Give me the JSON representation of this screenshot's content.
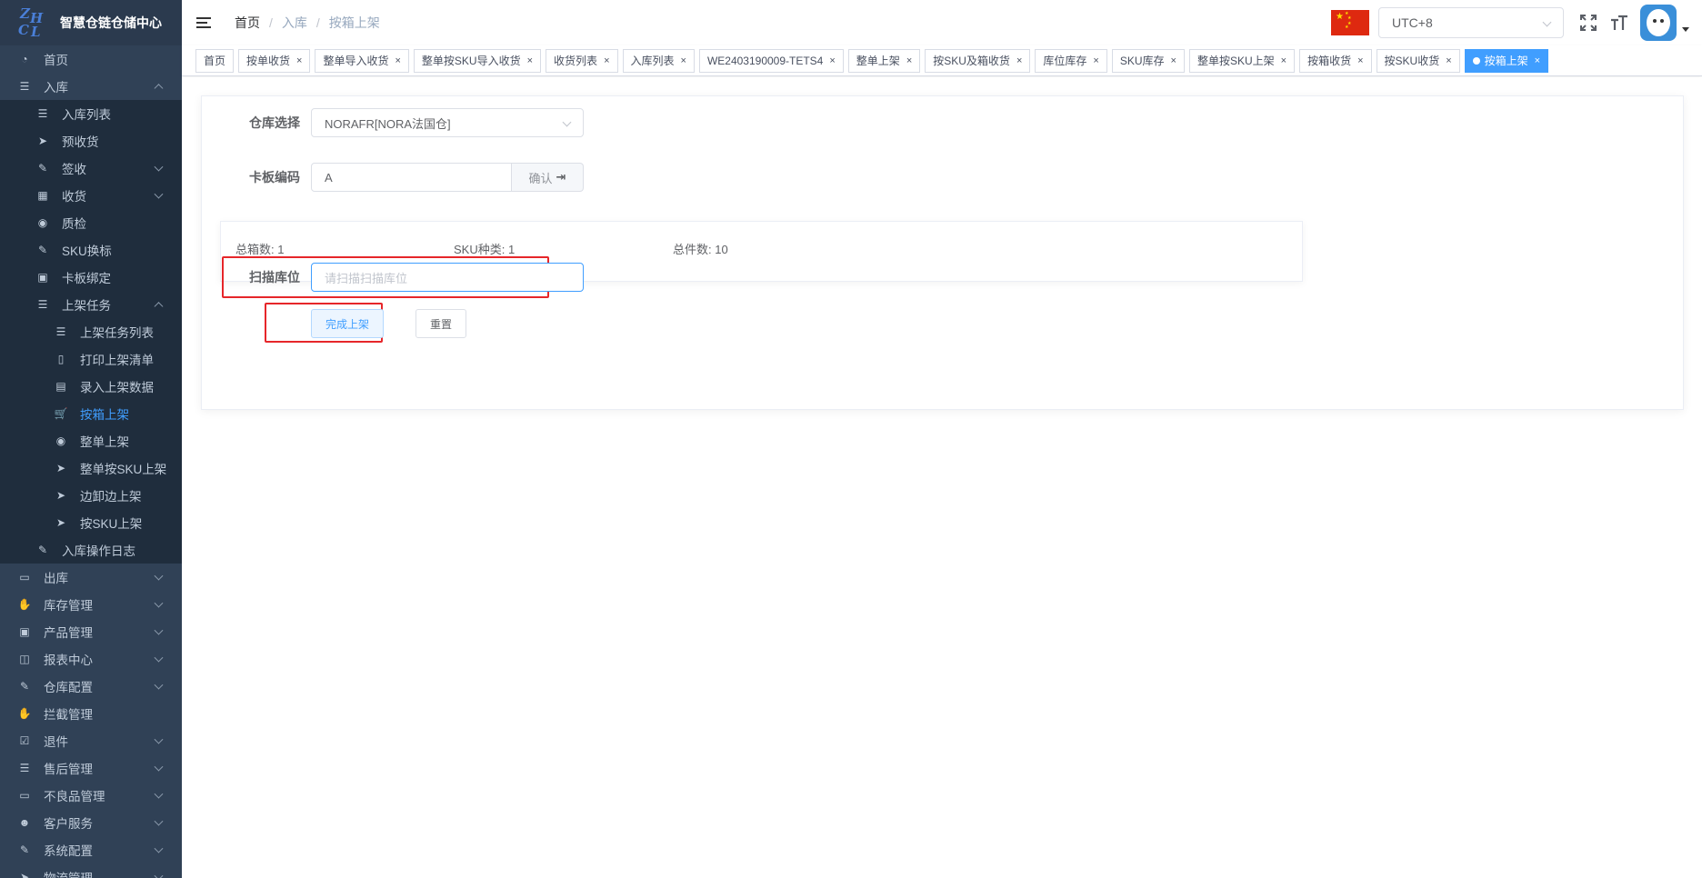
{
  "app": {
    "logo_letters": [
      "Z",
      "H",
      "C",
      "L"
    ],
    "title": "智慧仓链仓储中心"
  },
  "sidebar": {
    "items": [
      {
        "label": "首页",
        "icon": "dashboard-icon",
        "level": 1
      },
      {
        "label": "入库",
        "icon": "list-icon",
        "level": 1,
        "arrow": "up"
      },
      {
        "label": "入库列表",
        "icon": "list-icon",
        "level": 2
      },
      {
        "label": "预收货",
        "icon": "send-icon",
        "level": 2
      },
      {
        "label": "签收",
        "icon": "edit-icon",
        "level": 2,
        "arrow": "down"
      },
      {
        "label": "收货",
        "icon": "clapper-icon",
        "level": 2,
        "arrow": "down"
      },
      {
        "label": "质检",
        "icon": "eye-icon",
        "level": 2
      },
      {
        "label": "SKU换标",
        "icon": "edit-icon",
        "level": 2
      },
      {
        "label": "卡板绑定",
        "icon": "lock-icon",
        "level": 2
      },
      {
        "label": "上架任务",
        "icon": "list-icon",
        "level": 2,
        "arrow": "up"
      },
      {
        "label": "上架任务列表",
        "icon": "list-icon",
        "level": 3
      },
      {
        "label": "打印上架清单",
        "icon": "book-icon",
        "level": 3
      },
      {
        "label": "录入上架数据",
        "icon": "table-icon",
        "level": 3
      },
      {
        "label": "按箱上架",
        "icon": "cart-icon",
        "level": 3,
        "active": true
      },
      {
        "label": "整单上架",
        "icon": "radio-icon",
        "level": 3
      },
      {
        "label": "整单按SKU上架",
        "icon": "send-icon",
        "level": 3
      },
      {
        "label": "边卸边上架",
        "icon": "send-icon",
        "level": 3
      },
      {
        "label": "按SKU上架",
        "icon": "send-icon",
        "level": 3
      },
      {
        "label": "入库操作日志",
        "icon": "edit-icon",
        "level": 2
      },
      {
        "label": "出库",
        "icon": "monitor-icon",
        "level": 1,
        "arrow": "down"
      },
      {
        "label": "库存管理",
        "icon": "hand-icon",
        "level": 1,
        "arrow": "down"
      },
      {
        "label": "产品管理",
        "icon": "briefcase-icon",
        "level": 1,
        "arrow": "down"
      },
      {
        "label": "报表中心",
        "icon": "chart-icon",
        "level": 1,
        "arrow": "down"
      },
      {
        "label": "仓库配置",
        "icon": "edit-icon",
        "level": 1,
        "arrow": "down"
      },
      {
        "label": "拦截管理",
        "icon": "hand-icon",
        "level": 1
      },
      {
        "label": "退件",
        "icon": "checkbox-icon",
        "level": 1,
        "arrow": "down"
      },
      {
        "label": "售后管理",
        "icon": "list-icon",
        "level": 1,
        "arrow": "down"
      },
      {
        "label": "不良品管理",
        "icon": "monitor-icon",
        "level": 1,
        "arrow": "down"
      },
      {
        "label": "客户服务",
        "icon": "people-icon",
        "level": 1,
        "arrow": "down"
      },
      {
        "label": "系统配置",
        "icon": "edit-icon",
        "level": 1,
        "arrow": "down"
      },
      {
        "label": "物流管理",
        "icon": "send-icon",
        "level": 1,
        "arrow": "down"
      }
    ]
  },
  "header": {
    "breadcrumb": [
      "首页",
      "入库",
      "按箱上架"
    ],
    "timezone": "UTC+8"
  },
  "tags": [
    {
      "label": "首页",
      "closable": false
    },
    {
      "label": "按单收货",
      "closable": true
    },
    {
      "label": "整单导入收货",
      "closable": true
    },
    {
      "label": "整单按SKU导入收货",
      "closable": true
    },
    {
      "label": "收货列表",
      "closable": true
    },
    {
      "label": "入库列表",
      "closable": true
    },
    {
      "label": "WE2403190009-TETS4",
      "closable": true
    },
    {
      "label": "整单上架",
      "closable": true
    },
    {
      "label": "按SKU及箱收货",
      "closable": true
    },
    {
      "label": "库位库存",
      "closable": true
    },
    {
      "label": "SKU库存",
      "closable": true
    },
    {
      "label": "整单按SKU上架",
      "closable": true
    },
    {
      "label": "按箱收货",
      "closable": true
    },
    {
      "label": "按SKU收货",
      "closable": true
    },
    {
      "label": "按箱上架",
      "closable": true,
      "active": true
    }
  ],
  "form": {
    "warehouse_label": "仓库选择",
    "warehouse_value": "NORAFR[NORA法国仓]",
    "pallet_label": "卡板编码",
    "pallet_value": "A",
    "confirm_label": "确认",
    "scan_label": "扫描库位",
    "scan_placeholder": "请扫描扫描库位",
    "complete_label": "完成上架",
    "reset_label": "重置"
  },
  "stats": {
    "total_boxes_label": "总箱数:",
    "total_boxes": "1",
    "sku_types_label": "SKU种类:",
    "sku_types": "1",
    "total_pieces_label": "总件数:",
    "total_pieces": "10"
  },
  "colors": {
    "sidebar_bg": "#304156",
    "active": "#409eff",
    "highlight_box": "#e6262a"
  }
}
